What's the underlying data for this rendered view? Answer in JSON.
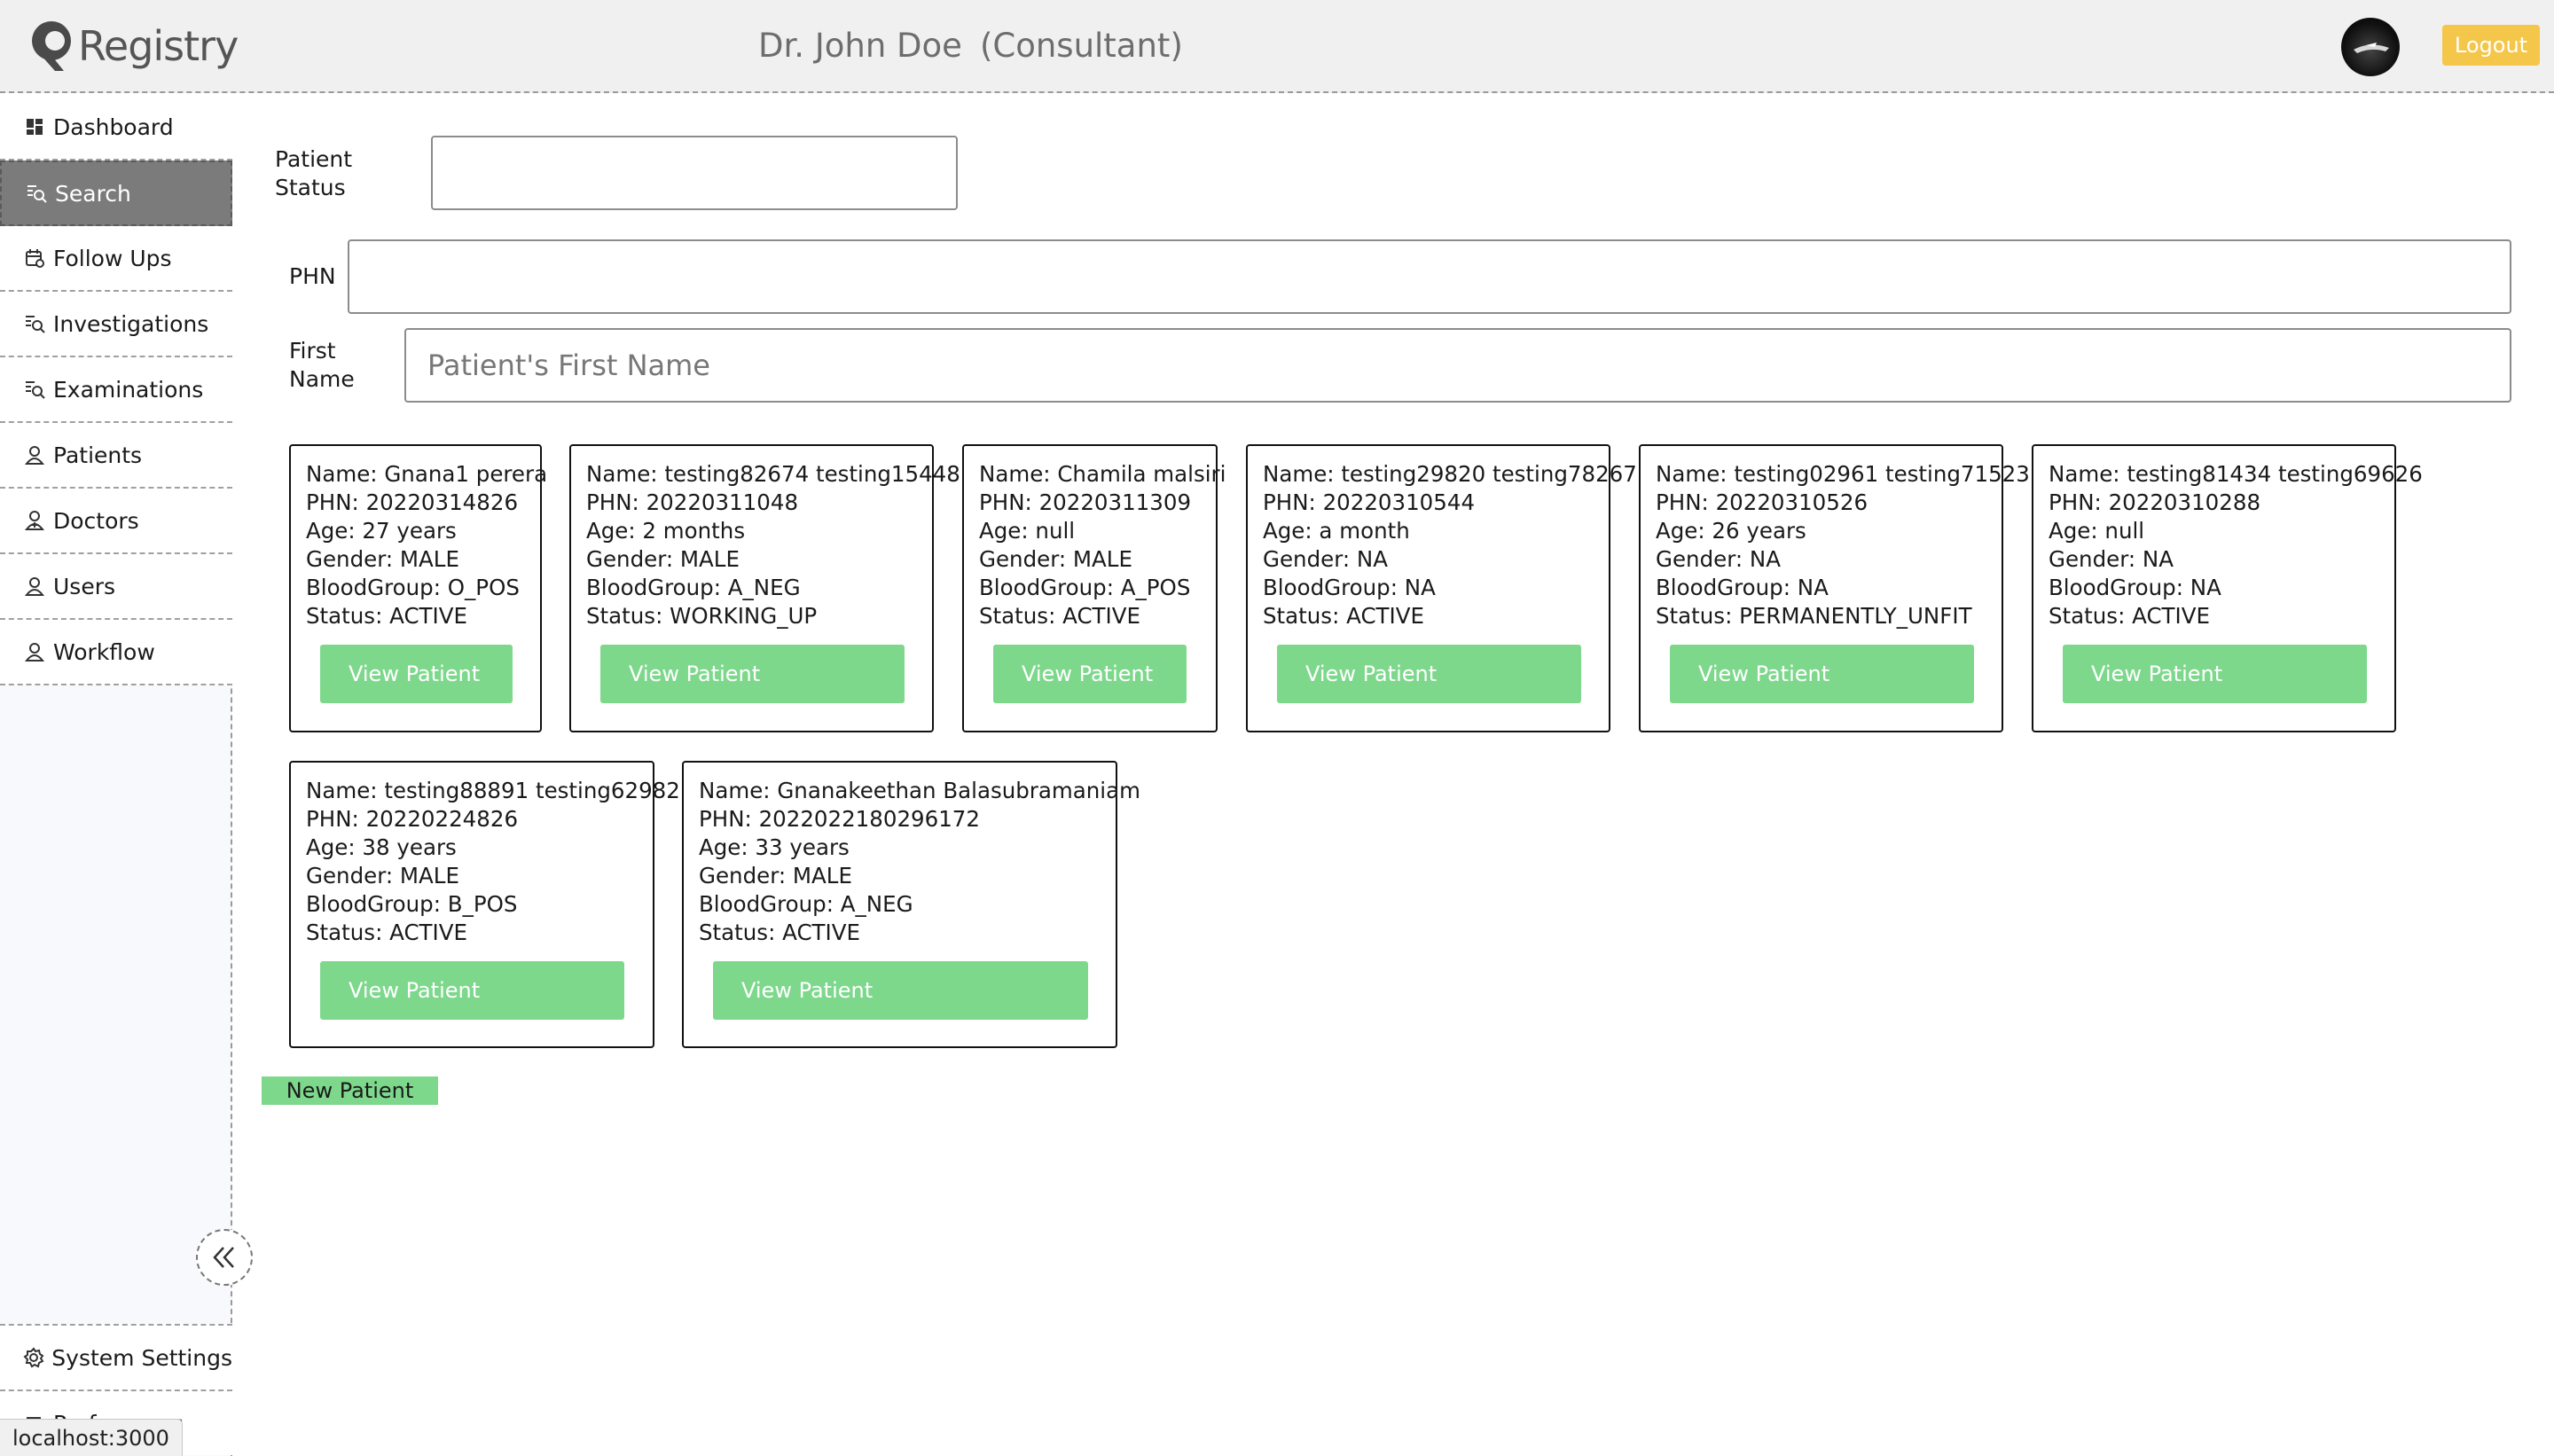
{
  "app": {
    "logo_text": "Registry"
  },
  "header": {
    "doctor_name": "Dr. John Doe",
    "doctor_role": "(Consultant)",
    "logout_label": "Logout"
  },
  "sidebar": {
    "items": [
      {
        "label": "Dashboard",
        "icon": "dashboard-icon"
      },
      {
        "label": "Search",
        "icon": "search-list-icon",
        "active": true
      },
      {
        "label": "Follow Ups",
        "icon": "calendar-icon"
      },
      {
        "label": "Investigations",
        "icon": "search-list-icon"
      },
      {
        "label": "Examinations",
        "icon": "search-list-icon"
      },
      {
        "label": "Patients",
        "icon": "user-icon"
      },
      {
        "label": "Doctors",
        "icon": "doctor-icon"
      },
      {
        "label": "Users",
        "icon": "user-icon"
      },
      {
        "label": "Workflow",
        "icon": "user-icon"
      }
    ],
    "bottom_items": [
      {
        "label": "System Settings",
        "icon": "gear-icon"
      },
      {
        "label": "Preferences",
        "icon": "sliders-icon"
      }
    ]
  },
  "form": {
    "patient_status_label": "Patient Status",
    "patient_status_value": "",
    "phn_label": "PHN",
    "phn_value": "",
    "first_name_label": "First Name",
    "first_name_placeholder": "Patient's First Name",
    "first_name_value": ""
  },
  "patients": [
    {
      "name": "Name: Gnana1 perera",
      "phn": "PHN: 20220314826",
      "age": "Age: 27 years",
      "gender": "Gender: MALE",
      "blood": "BloodGroup: O_POS",
      "status": "Status: ACTIVE"
    },
    {
      "name": "Name: testing82674 testing15448",
      "phn": "PHN: 20220311048",
      "age": "Age: 2 months",
      "gender": "Gender: MALE",
      "blood": "BloodGroup: A_NEG",
      "status": "Status: WORKING_UP"
    },
    {
      "name": "Name: Chamila malsiri",
      "phn": "PHN: 20220311309",
      "age": "Age: null",
      "gender": "Gender: MALE",
      "blood": "BloodGroup: A_POS",
      "status": "Status: ACTIVE"
    },
    {
      "name": "Name: testing29820 testing78267",
      "phn": "PHN: 20220310544",
      "age": "Age: a month",
      "gender": "Gender: NA",
      "blood": "BloodGroup: NA",
      "status": "Status: ACTIVE"
    },
    {
      "name": "Name: testing02961 testing71523",
      "phn": "PHN: 20220310526",
      "age": "Age: 26 years",
      "gender": "Gender: NA",
      "blood": "BloodGroup: NA",
      "status": "Status: PERMANENTLY_UNFIT"
    },
    {
      "name": "Name: testing81434 testing69626",
      "phn": "PHN: 20220310288",
      "age": "Age: null",
      "gender": "Gender: NA",
      "blood": "BloodGroup: NA",
      "status": "Status: ACTIVE"
    },
    {
      "name": "Name: testing88891 testing62982",
      "phn": "PHN: 20220224826",
      "age": "Age: 38 years",
      "gender": "Gender: MALE",
      "blood": "BloodGroup: B_POS",
      "status": "Status: ACTIVE"
    },
    {
      "name": "Name: Gnanakeethan Balasubramaniam",
      "phn": "PHN: 2022022180296172",
      "age": "Age: 33 years",
      "gender": "Gender: MALE",
      "blood": "BloodGroup: A_NEG",
      "status": "Status: ACTIVE"
    }
  ],
  "view_patient_label": "View Patient",
  "new_patient_label": "New Patient",
  "statusbar": {
    "url": "localhost:3000"
  },
  "colors": {
    "accent_green": "#7dd88c",
    "logout_yellow": "#f4c64a",
    "sidebar_active": "#7b7b7b"
  }
}
